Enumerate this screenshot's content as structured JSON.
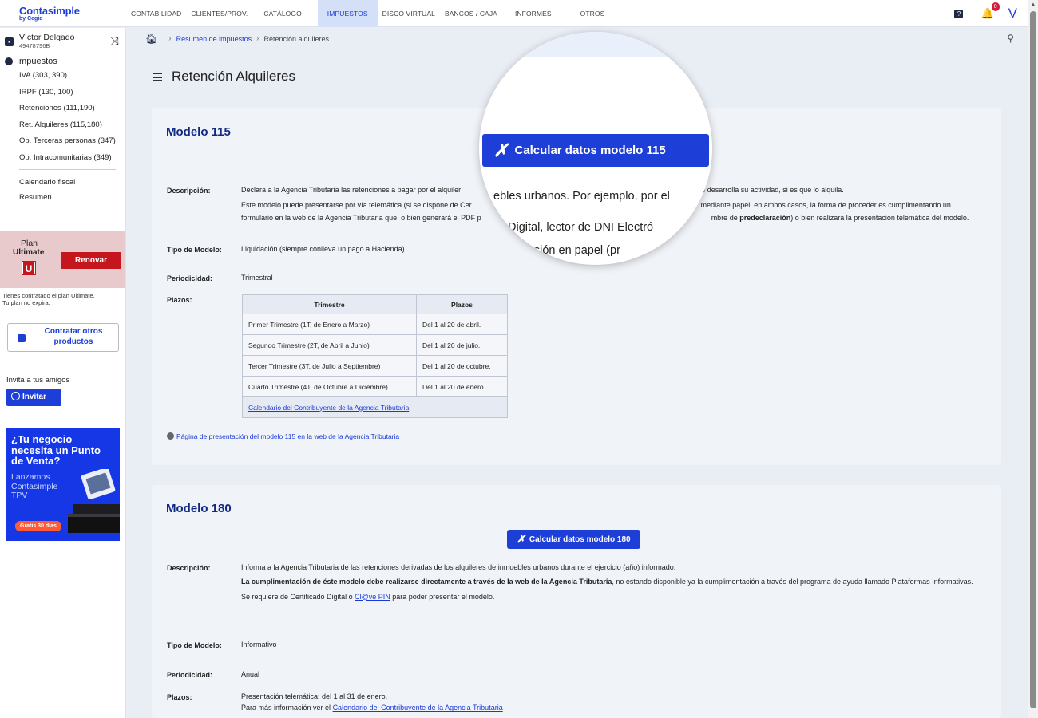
{
  "app": {
    "logo": "Contasimple",
    "logo_sub": "by Cegid"
  },
  "nav": {
    "items": [
      "CONTABILIDAD",
      "CLIENTES/PROV.",
      "CATÁLOGO",
      "IMPUESTOS",
      "DISCO VIRTUAL",
      "BANCOS / CAJA",
      "INFORMES",
      "OTROS"
    ],
    "active": "IMPUESTOS",
    "notif_count": "0",
    "help_icon": "question-icon",
    "bell_icon": "bell-icon",
    "user_initial": "V"
  },
  "user": {
    "name": "Víctor Delgado",
    "id": "49478796B"
  },
  "sidebar": {
    "section_title": "Impuestos",
    "items": [
      "IVA (303, 390)",
      "IRPF (130, 100)",
      "Retenciones (111,190)",
      "Ret. Alquileres (115,180)",
      "Op. Terceras personas (347)",
      "Op. Intracomunitarias (349)"
    ],
    "items2": [
      "Calendario fiscal",
      "Resumen"
    ],
    "plan_label": "Plan",
    "plan_name": "Ultimate",
    "plan_badge": "U",
    "renew_label": "Renovar",
    "plan_note_1": "Tienes contratado el plan Ultimate.",
    "plan_note_2": "Tu plan no expira.",
    "contract_label": "Contratar otros productos",
    "invite_text": "Invita a tus amigos",
    "invite_button": "Invitar",
    "ad_title": "¿Tu negocio necesita un Punto de Venta?",
    "ad_body": "Lanzamos Contasimple TPV",
    "ad_tag": "Gratis 30 días"
  },
  "breadcrumb": {
    "link": "Resumen de impuestos",
    "current": "Retención alquileres"
  },
  "page": {
    "title": "Retención Alquileres"
  },
  "model115": {
    "title": "Modelo 115",
    "button": "Calcular datos modelo 115",
    "desc_label": "Descripción:",
    "desc_1": "Declara a la Agencia Tributaria las retenciones a pagar por el alquiler",
    "desc_1_end": "onde desarrolla su actividad, si es que lo alquila.",
    "desc_2a": "Este modelo puede presentarse por vía telemática (si se dispone de Cer",
    "desc_2b": "mediante papel, en ambos casos, la forma de proceder es cumplimentando un",
    "desc_3a": "formulario en la web de la Agencia Tributaria que, o bien generará el PDF p",
    "desc_3b": "mbre de",
    "desc_3b_bold": "predeclaración",
    "desc_3c": ") o bien realizará la presentación telemática del modelo.",
    "type_label": "Tipo de Modelo:",
    "type": "Liquidación (siempre conlleva un pago a Hacienda).",
    "period_label": "Periodicidad:",
    "period": "Trimestral",
    "deadlines_label": "Plazos:",
    "table_headers": [
      "Trimestre",
      "Plazos"
    ],
    "table_rows": [
      [
        "Primer Trimestre (1T, de Enero a Marzo)",
        "Del 1 al 20 de abril."
      ],
      [
        "Segundo Trimestre (2T, de Abril a Junio)",
        "Del 1 al 20 de julio."
      ],
      [
        "Tercer Trimestre (3T, de Julio a Septiembre)",
        "Del 1 al 20 de octubre."
      ],
      [
        "Cuarto Trimestre (4T, de Octubre a Diciembre)",
        "Del 1 al 20 de enero."
      ]
    ],
    "table_link": "Calendario del Contribuyente de la Agencia Tributaria",
    "page_link": "Página de presentación del modelo 115 en la web de la Agencia Tributaria"
  },
  "magnifier": {
    "button": "Calcular datos modelo 115",
    "line1": "ebles urbanos. Por ejemplo, por el",
    "line2": "Digital, lector de DNI Electró",
    "line3": "resión en papel (pr"
  },
  "model180": {
    "title": "Modelo 180",
    "button": "Calcular datos modelo 180",
    "desc_label": "Descripción:",
    "desc_1": "Informa a la Agencia Tributaria de las retenciones derivadas de los alquileres de inmuebles urbanos durante el ejercicio (año) informado.",
    "desc_2_bold": "La cumplimentación de éste modelo debe realizarse directamente a través de la web de la Agencia Tributaria",
    "desc_2_rest": ", no estando disponible ya la cumplimentación a través del programa de ayuda llamado Plataformas Informativas.",
    "desc_3a": "Se requiere de Certificado Digital o",
    "desc_3_link": "Cl@ve PIN",
    "desc_3b": "para poder presentar el modelo.",
    "type_label": "Tipo de Modelo:",
    "type": "Informativo",
    "period_label": "Periodicidad:",
    "period": "Anual",
    "deadlines_label": "Plazos:",
    "deadline_1": "Presentación telemática: del 1 al 31 de enero.",
    "deadline_2a": "Para más información ver el",
    "deadline_2_link": "Calendario del Contribuyente de la Agencia Tributaria"
  }
}
